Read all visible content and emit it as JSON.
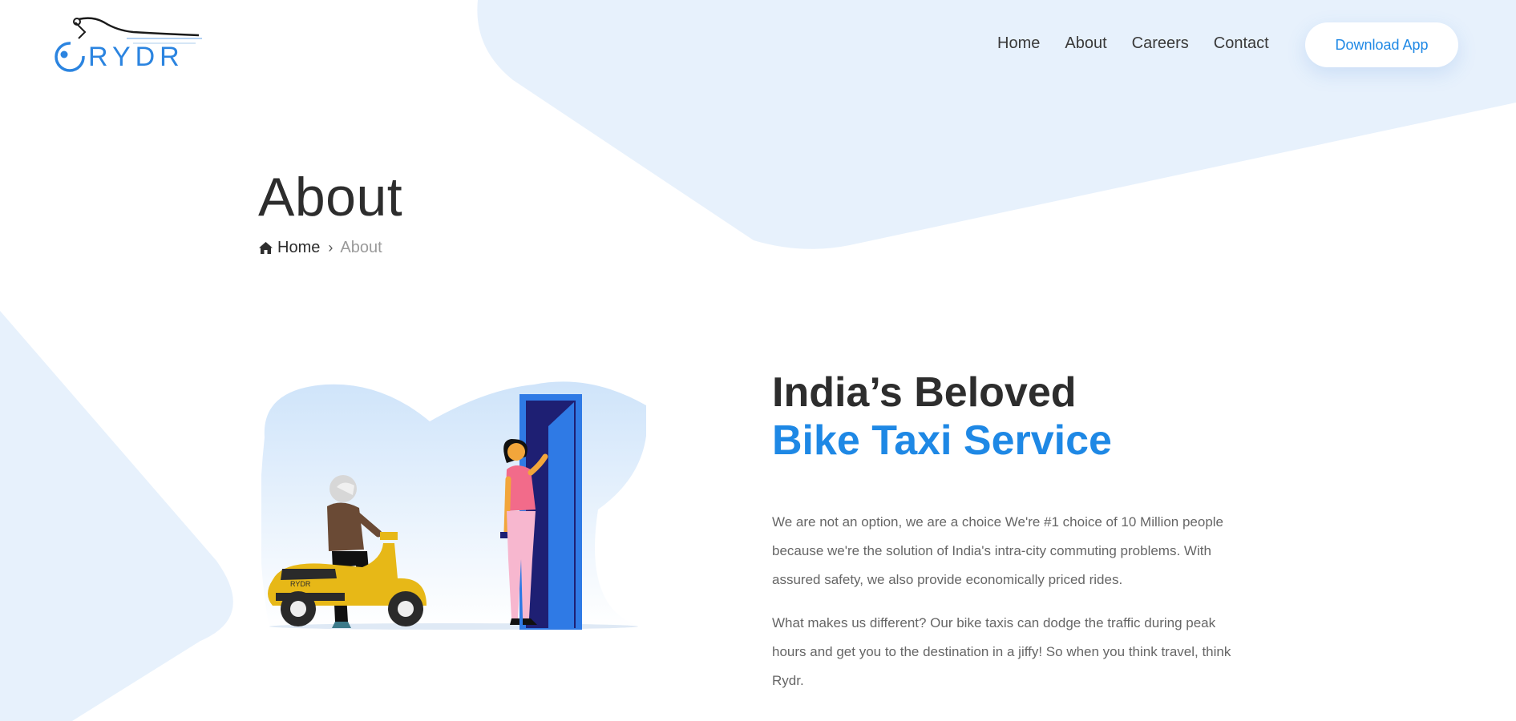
{
  "brand": {
    "name": "RYDR",
    "accent_color": "#1e88e5",
    "bg_shape_color": "#e7f1fc"
  },
  "nav": {
    "items": [
      {
        "label": "Home"
      },
      {
        "label": "About"
      },
      {
        "label": "Careers"
      },
      {
        "label": "Contact"
      }
    ],
    "download_label": "Download App"
  },
  "page": {
    "title": "About",
    "breadcrumb": {
      "home_icon": "home-icon",
      "home": "Home",
      "separator": "›",
      "current": "About"
    }
  },
  "about": {
    "heading_line1": "India’s Beloved",
    "heading_line2": "Bike Taxi Service",
    "paragraphs": [
      "We are not an option, we are a choice We're #1 choice of 10 Million people because we're the solution of India's intra-city commuting problems. With assured safety, we also provide economically priced rides.",
      "What makes us different? Our bike taxis can dodge the traffic during peak hours and get you to the destination in a jiffy! So when you think travel, think Rydr."
    ],
    "illustration": {
      "scooter_badge": "RYDR"
    }
  }
}
